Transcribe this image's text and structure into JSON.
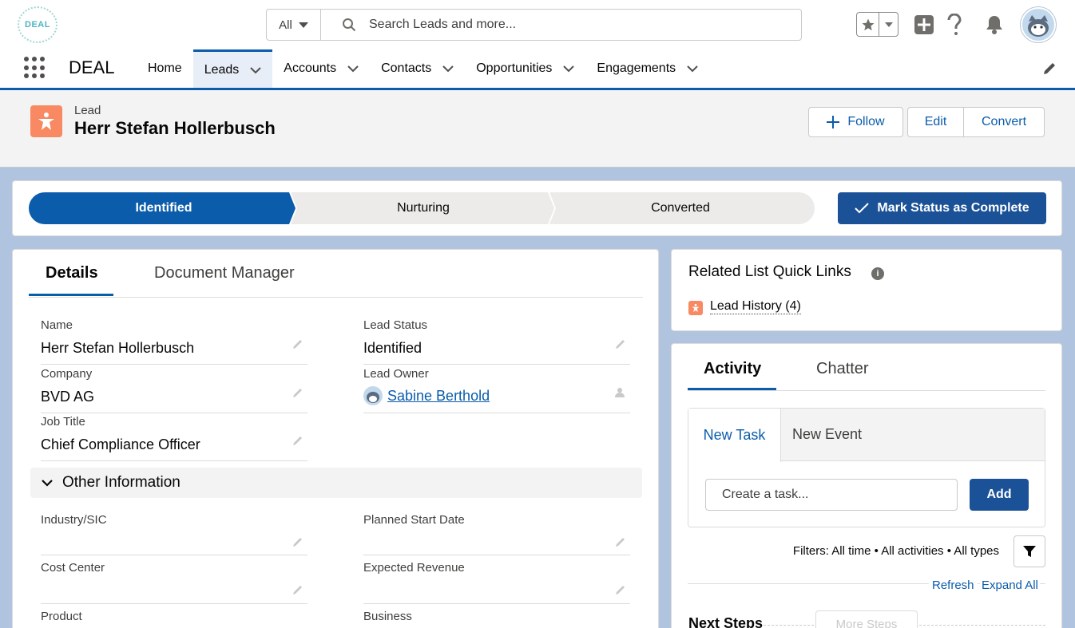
{
  "header": {
    "logo_text": "DEAL",
    "search": {
      "scope": "All",
      "placeholder": "Search Leads and more..."
    }
  },
  "nav": {
    "app_name": "DEAL",
    "tabs": [
      {
        "label": "Home",
        "has_menu": false,
        "active": false
      },
      {
        "label": "Leads",
        "has_menu": true,
        "active": true
      },
      {
        "label": "Accounts",
        "has_menu": true,
        "active": false
      },
      {
        "label": "Contacts",
        "has_menu": true,
        "active": false
      },
      {
        "label": "Opportunities",
        "has_menu": true,
        "active": false
      },
      {
        "label": "Engagements",
        "has_menu": true,
        "active": false
      }
    ]
  },
  "record": {
    "type": "Lead",
    "title": "Herr Stefan Hollerbusch",
    "actions": {
      "follow": "Follow",
      "edit": "Edit",
      "convert": "Convert"
    }
  },
  "path": {
    "stages": [
      {
        "label": "Identified",
        "state": "current"
      },
      {
        "label": "Nurturing",
        "state": "incomplete"
      },
      {
        "label": "Converted",
        "state": "incomplete"
      }
    ],
    "mark_button": "Mark Status as Complete"
  },
  "details": {
    "tabs": [
      "Details",
      "Document Manager"
    ],
    "fields": [
      {
        "label": "Name",
        "value": "Herr Stefan Hollerbusch"
      },
      {
        "label": "Lead Status",
        "value": "Identified"
      },
      {
        "label": "Company",
        "value": "BVD AG"
      },
      {
        "label": "Lead Owner",
        "value": "Sabine Berthold"
      },
      {
        "label": "Job Title",
        "value": "Chief Compliance Officer"
      }
    ],
    "section_title": "Other Information",
    "other_fields": [
      {
        "label": "Industry/SIC",
        "value": ""
      },
      {
        "label": "Planned Start Date",
        "value": ""
      },
      {
        "label": "Cost Center",
        "value": ""
      },
      {
        "label": "Expected Revenue",
        "value": ""
      },
      {
        "label": "Product",
        "value": ""
      },
      {
        "label": "Business",
        "value": ""
      }
    ]
  },
  "quick_links": {
    "title": "Related List Quick Links",
    "links": [
      {
        "label": "Lead History (4)"
      }
    ]
  },
  "activity": {
    "tabs": [
      "Activity",
      "Chatter"
    ],
    "composer_tabs": [
      "New Task",
      "New Event"
    ],
    "task_placeholder": "Create a task...",
    "add_label": "Add",
    "filters": "Filters: All time • All activities • All types",
    "refresh": "Refresh",
    "expand_all": "Expand All",
    "next_steps": "Next Steps",
    "more_steps": "More Steps"
  },
  "colors": {
    "brand": "#0b5cab",
    "lead_icon": "#f88962",
    "button_brand": "#1b5297"
  }
}
